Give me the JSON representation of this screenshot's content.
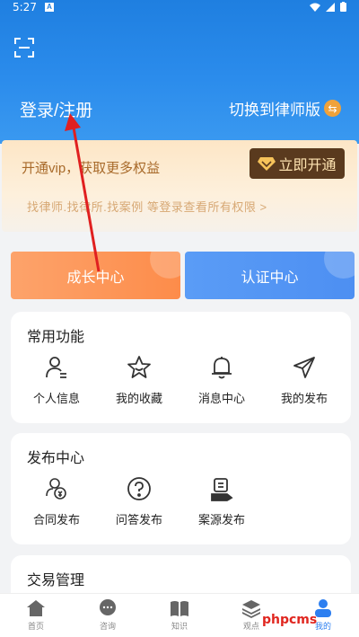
{
  "status": {
    "time": "5:27",
    "a_badge": "A"
  },
  "header": {
    "scan_icon": "scan-icon",
    "login_label": "登录/注册",
    "switch_label": "切换到律师版",
    "switch_icon": "swap-icon",
    "bg_color": "#2b8cec"
  },
  "vip": {
    "title": "开通vip，获取更多权益",
    "button_label": "立即开通",
    "subtitle": "找律师.找律所.找案例 等登录查看所有权限 >"
  },
  "cards": {
    "growth": "成长中心",
    "cert": "认证中心"
  },
  "common": {
    "title": "常用功能",
    "items": [
      {
        "label": "个人信息",
        "icon": "person-info-icon"
      },
      {
        "label": "我的收藏",
        "icon": "star-icon"
      },
      {
        "label": "消息中心",
        "icon": "bell-icon"
      },
      {
        "label": "我的发布",
        "icon": "send-icon"
      }
    ]
  },
  "publish": {
    "title": "发布中心",
    "items": [
      {
        "label": "合同发布",
        "icon": "coins-icon"
      },
      {
        "label": "问答发布",
        "icon": "question-icon"
      },
      {
        "label": "案源发布",
        "icon": "case-icon"
      }
    ]
  },
  "trade": {
    "title": "交易管理"
  },
  "tabbar": {
    "items": [
      {
        "label": "首页",
        "icon": "home-icon"
      },
      {
        "label": "咨询",
        "icon": "chat-icon"
      },
      {
        "label": "知识",
        "icon": "book-icon"
      },
      {
        "label": "观点",
        "icon": "layers-icon"
      },
      {
        "label": "我的",
        "icon": "profile-icon"
      }
    ],
    "active_color": "#2d7ff0"
  },
  "watermark": "phpcms"
}
